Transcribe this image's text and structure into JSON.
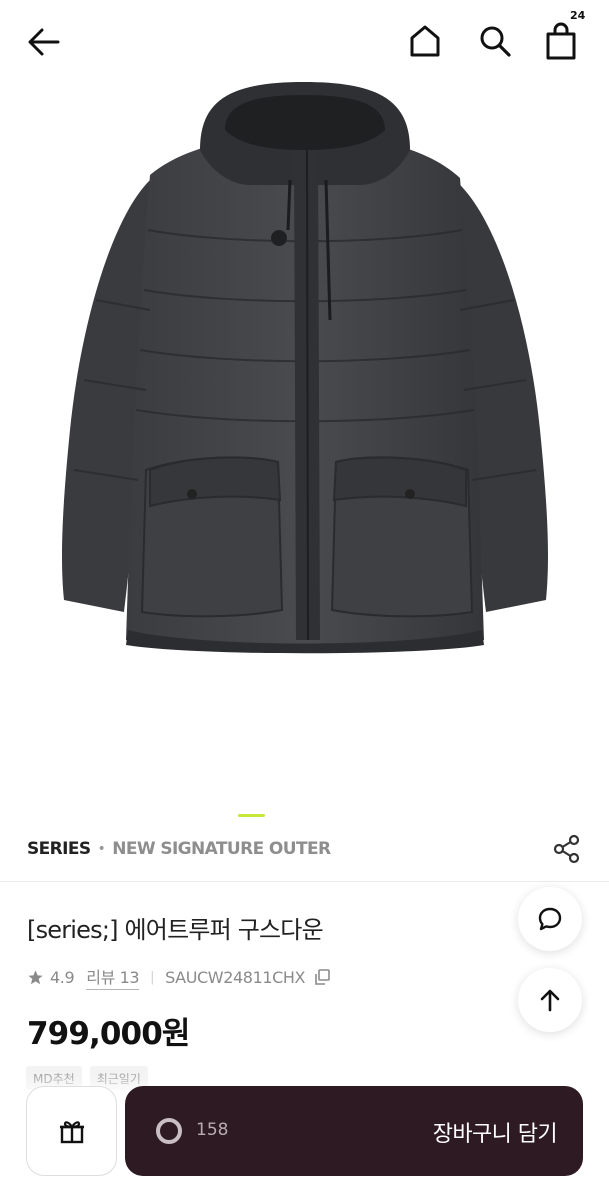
{
  "header": {
    "cart_count": "24",
    "icons": [
      "back-arrow-icon",
      "home-icon",
      "search-icon",
      "shopping-bag-icon"
    ]
  },
  "gallery": {
    "image_subject": "dark charcoal hooded goose down parka",
    "indicator_color": "#c6e83a"
  },
  "breadcrumb": {
    "brand": "SERIES",
    "separator": "•",
    "category": "NEW SIGNATURE OUTER"
  },
  "product": {
    "title": "[series;] 에어트루퍼 구스다운",
    "rating": "4.9",
    "review_label": "리뷰 13",
    "meta_separator": "|",
    "product_code": "SAUCW24811CHX",
    "price": "799,000원",
    "chips": [
      "MD추천",
      "최근일기"
    ]
  },
  "floating": {
    "chat_icon": "chat-bubble-icon",
    "top_icon": "arrow-up-icon"
  },
  "bottom_bar": {
    "gift_icon": "gift-icon",
    "like_count": "158",
    "add_to_cart_label": "장바구니 담기",
    "button_color": "#2d1a22"
  }
}
